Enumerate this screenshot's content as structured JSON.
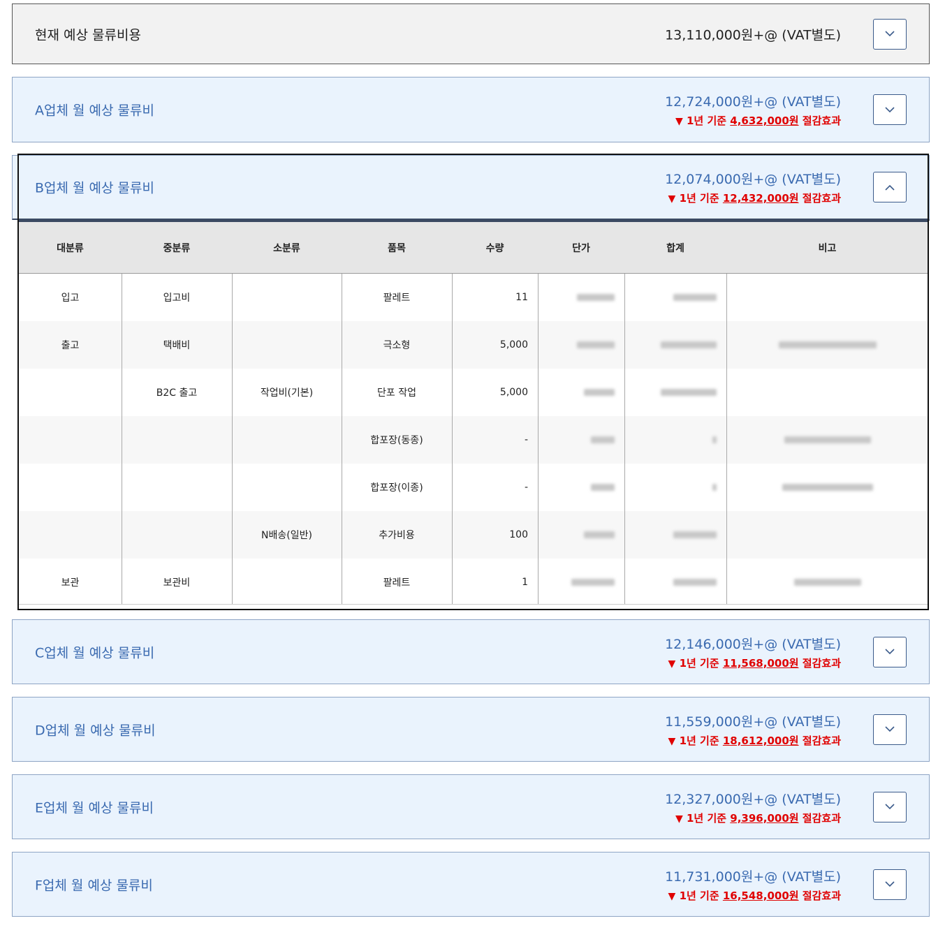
{
  "current": {
    "title": "현재 예상 물류비용",
    "price": "13,110,000원+@ (VAT별도)"
  },
  "vendors": [
    {
      "title": "A업체 월 예상 물류비",
      "price": "12,724,000원+@ (VAT별도)",
      "saving_prefix": "1년 기준",
      "saving_amount": "4,632,000원",
      "saving_suffix": "절감효과",
      "expanded": false
    },
    {
      "title": "B업체 월 예상 물류비",
      "price": "12,074,000원+@ (VAT별도)",
      "saving_prefix": "1년 기준",
      "saving_amount": "12,432,000원",
      "saving_suffix": "절감효과",
      "expanded": true
    },
    {
      "title": "C업체 월 예상 물류비",
      "price": "12,146,000원+@ (VAT별도)",
      "saving_prefix": "1년 기준",
      "saving_amount": "11,568,000원",
      "saving_suffix": "절감효과",
      "expanded": false
    },
    {
      "title": "D업체 월 예상 물류비",
      "price": "11,559,000원+@ (VAT별도)",
      "saving_prefix": "1년 기준",
      "saving_amount": "18,612,000원",
      "saving_suffix": "절감효과",
      "expanded": false
    },
    {
      "title": "E업체 월 예상 물류비",
      "price": "12,327,000원+@ (VAT별도)",
      "saving_prefix": "1년 기준",
      "saving_amount": "9,396,000원",
      "saving_suffix": "절감효과",
      "expanded": false
    },
    {
      "title": "F업체 월 예상 물류비",
      "price": "11,731,000원+@ (VAT별도)",
      "saving_prefix": "1년 기준",
      "saving_amount": "16,548,000원",
      "saving_suffix": "절감효과",
      "expanded": false
    }
  ],
  "table": {
    "headers": [
      "대분류",
      "중분류",
      "소분류",
      "품목",
      "수량",
      "단가",
      "합계",
      "비고"
    ],
    "rows": [
      [
        "입고",
        "입고비",
        "",
        "팔레트",
        "11"
      ],
      [
        "출고",
        "택배비",
        "",
        "극소형",
        "5,000"
      ],
      [
        "",
        "B2C 출고",
        "작업비(기본)",
        "단포 작업",
        "5,000"
      ],
      [
        "",
        "",
        "",
        "합포장(동종)",
        "-"
      ],
      [
        "",
        "",
        "",
        "합포장(이종)",
        "-"
      ],
      [
        "",
        "",
        "N배송(일반)",
        "추가비용",
        "100"
      ],
      [
        "보관",
        "보관비",
        "",
        "팔레트",
        "1"
      ]
    ]
  },
  "icons": {
    "collapsed": "chevron-down-icon",
    "expanded": "chevron-up-icon",
    "saving": "triangle-down-icon"
  },
  "colors": {
    "accent": "#3a6ab0",
    "saving": "#e00000",
    "panel_bg": "#eaf3fd",
    "current_bg": "#f2f2f2"
  }
}
